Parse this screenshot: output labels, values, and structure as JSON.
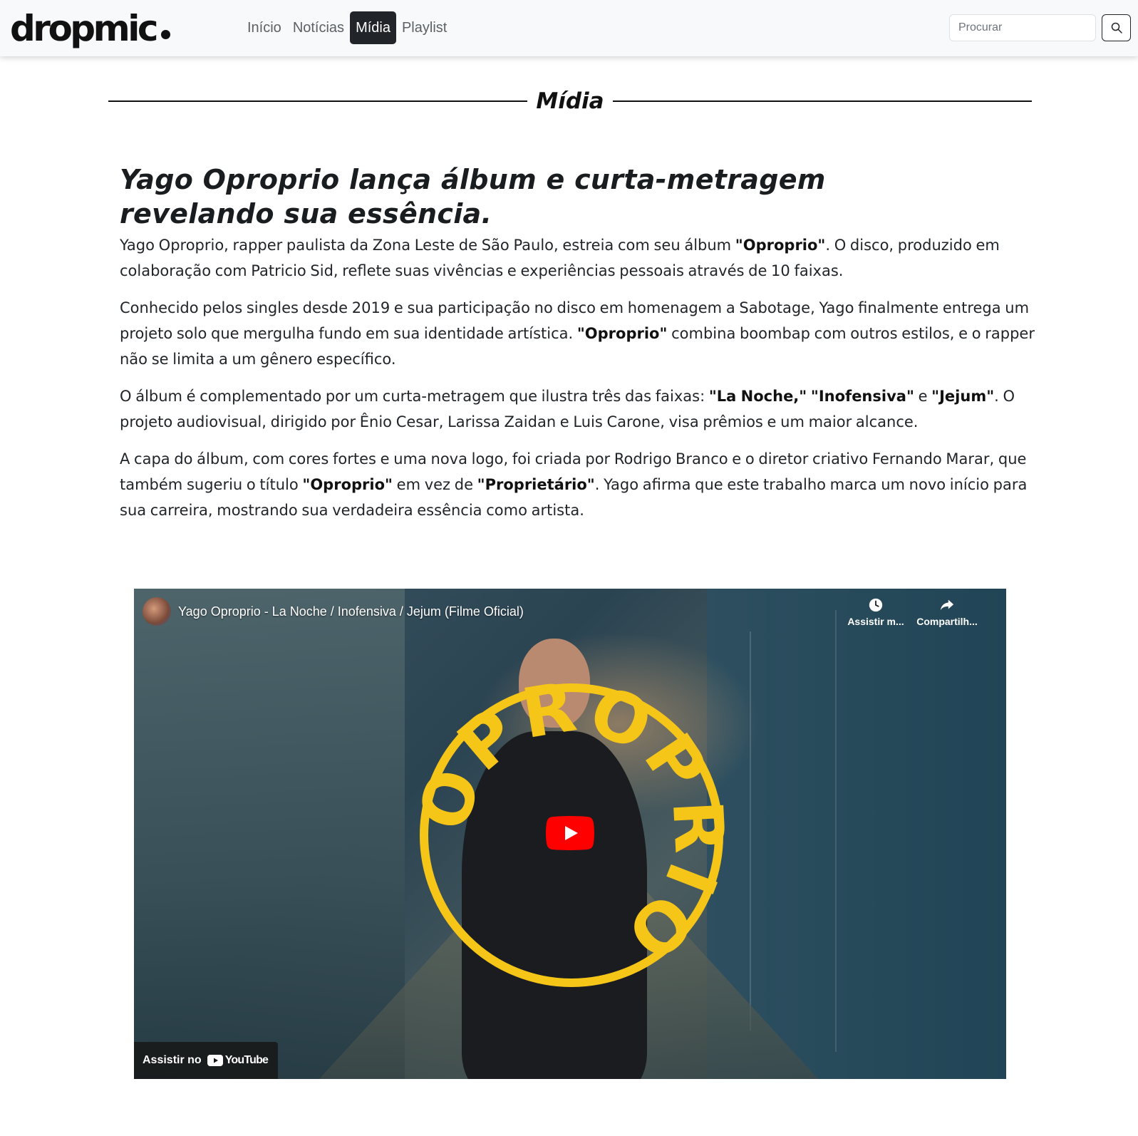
{
  "brand": {
    "name": "dropmic"
  },
  "nav": {
    "items": [
      {
        "label": "Início",
        "active": false
      },
      {
        "label": "Notícias",
        "active": false
      },
      {
        "label": "Mídia",
        "active": true
      },
      {
        "label": "Playlist",
        "active": false
      }
    ]
  },
  "search": {
    "placeholder": "Procurar",
    "value": "",
    "button_icon": "search-icon"
  },
  "section": {
    "title": "Mídia"
  },
  "article": {
    "title": "Yago Oproprio lança álbum e curta-metragem revelando sua essência.",
    "p1": {
      "a": "Yago Oproprio, rapper paulista da Zona Leste de São Paulo, estreia com seu álbum ",
      "b1": "\"Oproprio\"",
      "c": ". O disco, produzido em colaboração com Patricio Sid, reflete suas vivências e experiências pessoais através de 10 faixas."
    },
    "p2": {
      "a": "Conhecido pelos singles desde 2019 e sua participação no disco em homenagem a Sabotage, Yago finalmente entrega um projeto solo que mergulha fundo em sua identidade artística. ",
      "b1": "\"Oproprio\"",
      "c": " combina boombap com outros estilos, e o rapper não se limita a um gênero específico."
    },
    "p3": {
      "a": "O álbum é complementado por um curta-metragem que ilustra três das faixas: ",
      "b1": "\"La Noche,\"",
      "sp": " ",
      "b2": "\"Inofensiva\"",
      "c": " e ",
      "b3": "\"Jejum\"",
      "d": ". O projeto audiovisual, dirigido por Ênio Cesar, Larissa Zaidan e Luis Carone, visa prêmios e um maior alcance."
    },
    "p4": {
      "a": "A capa do álbum, com cores fortes e uma nova logo, foi criada por Rodrigo Branco e o diretor criativo Fernando Marar, que também sugeriu o título ",
      "b1": "\"Oproprio\"",
      "c": " em vez de ",
      "b2": "\"Proprietário\"",
      "d": ". Yago afirma que este trabalho marca um novo início para sua carreira, mostrando sua verdadeira essência como artista."
    }
  },
  "video": {
    "title": "Yago Oproprio - La Noche / Inofensiva / Jejum (Filme Oficial)",
    "watch_later": "Assistir m...",
    "share": "Compartilh...",
    "watch_on": "Assistir no",
    "youtube": "YouTube",
    "logo_text": "OPROPRIO",
    "logo_color": "#f5c518",
    "play_color": "#ff0000"
  },
  "colors": {
    "navbar_bg": "#f8f9fa",
    "active_nav_bg": "#212529",
    "text": "#212529"
  }
}
